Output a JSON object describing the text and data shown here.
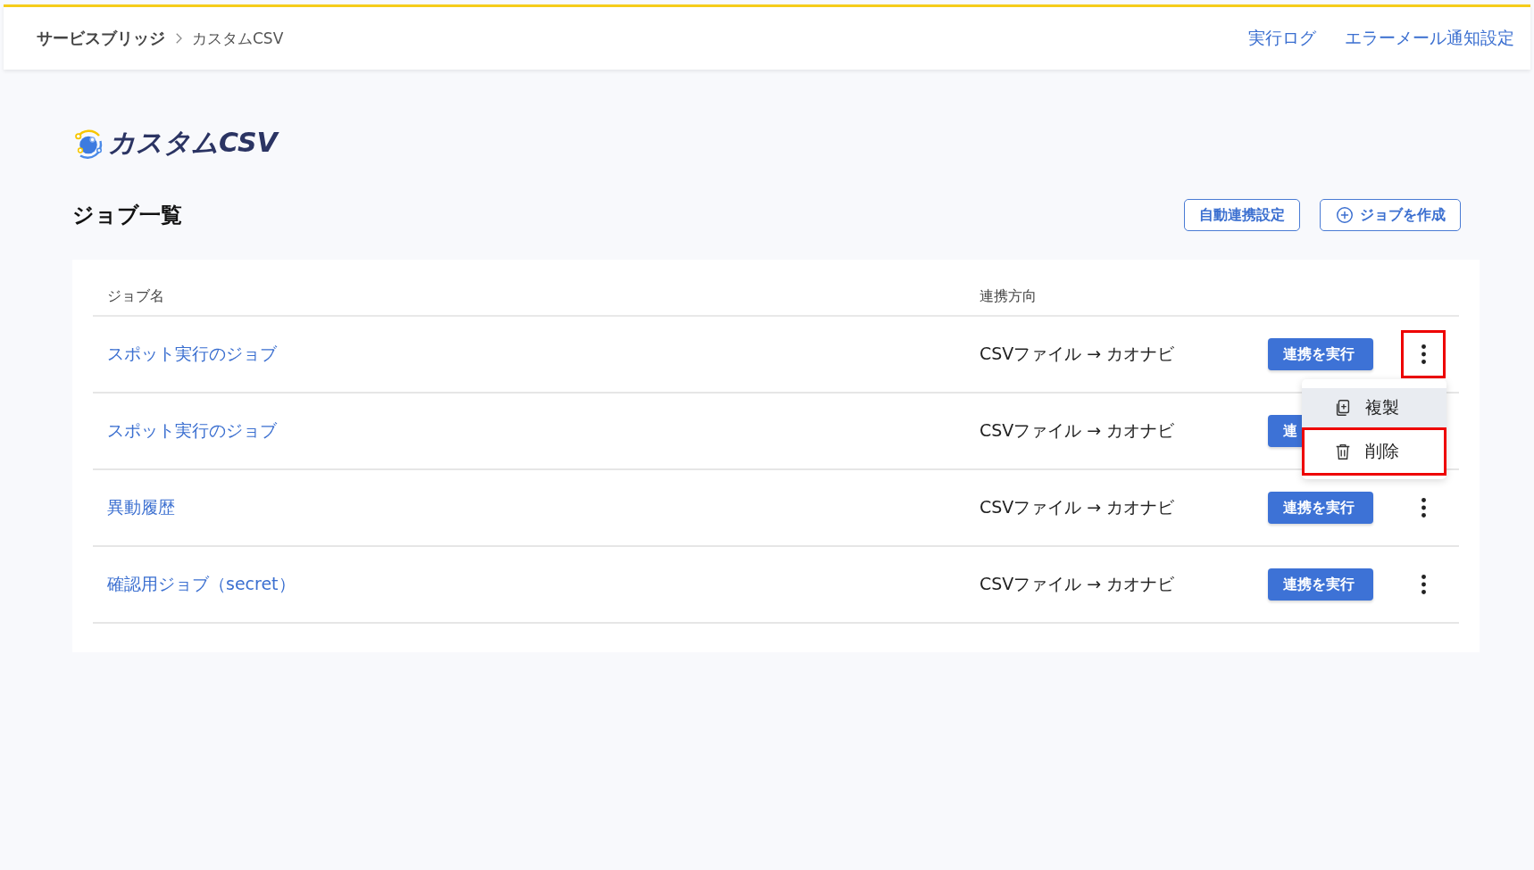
{
  "breadcrumb": [
    {
      "label": "サービスブリッジ",
      "current": false
    },
    {
      "label": "カスタムCSV",
      "current": true
    }
  ],
  "header_links": [
    "実行ログ",
    "エラーメール通知設定"
  ],
  "logo": {
    "text": "カスタムCSV"
  },
  "page_title": "ジョブ一覧",
  "toolbar_buttons": [
    {
      "kind": "text",
      "label": "自動連携設定"
    },
    {
      "kind": "add",
      "label": "ジョブを作成"
    }
  ],
  "table": {
    "columns": [
      "ジョブ名",
      "連携方向"
    ],
    "rows": [
      {
        "name": "スポット実行のジョブ",
        "direction": "CSVファイル → カオナビ",
        "run_label": "連携を実行",
        "kind": "open"
      },
      {
        "name": "スポット実行のジョブ",
        "direction": "CSVファイル → カオナビ",
        "run_label": "連",
        "kind": "covered"
      },
      {
        "name": "異動履歴",
        "direction": "CSVファイル → カオナビ",
        "run_label": "連携を実行",
        "kind": "plain"
      },
      {
        "name": "確認用ジョブ（secret）",
        "direction": "CSVファイル → カオナビ",
        "run_label": "連携を実行",
        "kind": "plain"
      }
    ]
  },
  "context_menu": {
    "items": [
      {
        "kind": "copy",
        "label": "複製",
        "hovered": true,
        "highlighted": false
      },
      {
        "kind": "trash",
        "label": "削除",
        "hovered": false,
        "highlighted": true
      }
    ]
  }
}
